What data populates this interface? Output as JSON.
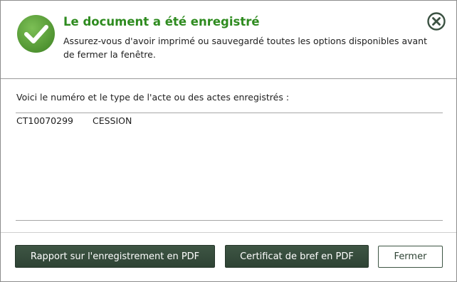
{
  "dialog": {
    "title": "Le document a été enregistré",
    "subtitle": "Assurez-vous d'avoir imprimé ou sauvegardé toutes les options disponibles avant de fermer la fenêtre.",
    "icon": "check-circle-icon",
    "close_icon": "close-circle-icon",
    "colors": {
      "title_green": "#2e8b1f",
      "icon_green": "#5a9e3a",
      "button_dark": "#344a3a"
    }
  },
  "content": {
    "intro": "Voici le numéro et le type de l'acte ou des actes enregistrés :",
    "acts": [
      {
        "number": "CT10070299",
        "type": "CESSION"
      }
    ]
  },
  "footer": {
    "report_label": "Rapport sur l'enregistrement en PDF",
    "certificate_label": "Certificat de bref en PDF",
    "close_label": "Fermer"
  }
}
